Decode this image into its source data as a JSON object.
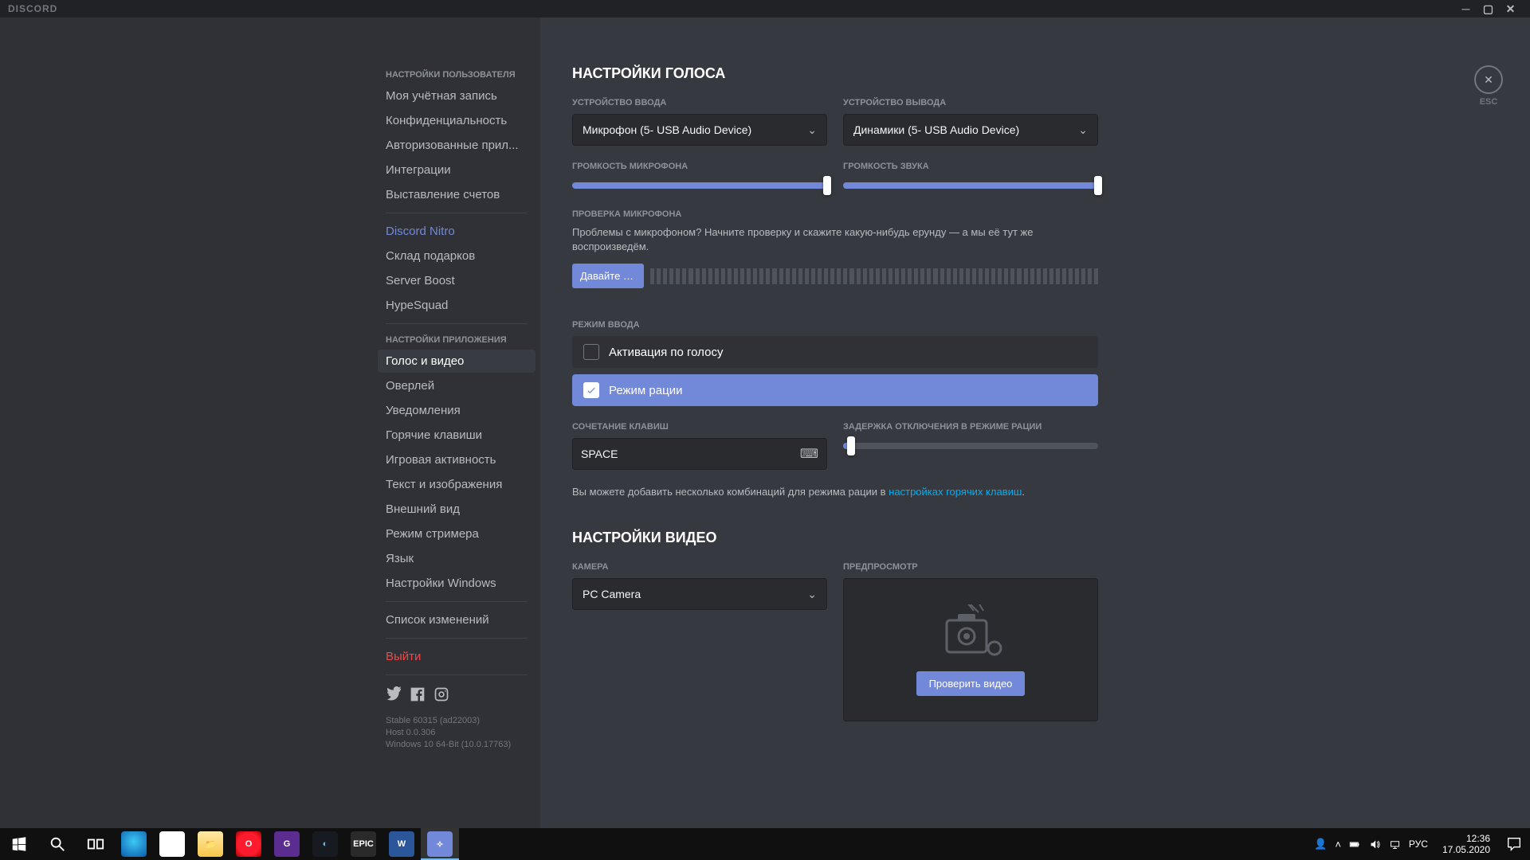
{
  "window": {
    "title": "DISCORD",
    "close_key_label": "ESC"
  },
  "sidebar": {
    "header_user": "НАСТРОЙКИ ПОЛЬЗОВАТЕЛЯ",
    "user_items": [
      "Моя учётная запись",
      "Конфиденциальность",
      "Авторизованные прил...",
      "Интеграции",
      "Выставление счетов"
    ],
    "nitro": "Discord Nitro",
    "nitro_items": [
      "Склад подарков",
      "Server Boost",
      "HypeSquad"
    ],
    "header_app": "НАСТРОЙКИ ПРИЛОЖЕНИЯ",
    "app_items": [
      "Голос и видео",
      "Оверлей",
      "Уведомления",
      "Горячие клавиши",
      "Игровая активность",
      "Текст и изображения",
      "Внешний вид",
      "Режим стримера",
      "Язык",
      "Настройки Windows"
    ],
    "changelog": "Список изменений",
    "logout": "Выйти",
    "version_lines": [
      "Stable 60315 (ad22003)",
      "Host 0.0.306",
      "Windows 10 64-Bit (10.0.17763)"
    ]
  },
  "voice": {
    "title": "НАСТРОЙКИ ГОЛОСА",
    "input_label": "УСТРОЙСТВО ВВОДА",
    "input_device": "Микрофон (5- USB Audio Device)",
    "output_label": "УСТРОЙСТВО ВЫВОДА",
    "output_device": "Динамики (5- USB Audio Device)",
    "input_vol_label": "ГРОМКОСТЬ МИКРОФОНА",
    "input_vol_pct": 100,
    "output_vol_label": "ГРОМКОСТЬ ЗВУКА",
    "output_vol_pct": 100,
    "mictest_label": "ПРОВЕРКА МИКРОФОНА",
    "mictest_hint": "Проблемы с микрофоном? Начните проверку и скажите какую-нибудь ерунду — а мы её тут же воспроизведём.",
    "mictest_button": "Давайте пр...",
    "inputmode_label": "РЕЖИМ ВВОДА",
    "inputmode_voice": "Активация по голосу",
    "inputmode_ptt": "Режим рации",
    "shortcut_label": "СОЧЕТАНИЕ КЛАВИШ",
    "shortcut_value": "SPACE",
    "delay_label": "ЗАДЕРЖКА ОТКЛЮЧЕНИЯ В РЕЖИМЕ РАЦИИ",
    "delay_pct": 3,
    "shortcut_hint_a": "Вы можете добавить несколько комбинаций для режима рации в ",
    "shortcut_hint_link": "настройках горячих клавиш",
    "shortcut_hint_b": "."
  },
  "video": {
    "title": "НАСТРОЙКИ ВИДЕО",
    "cam_label": "КАМЕРА",
    "cam_device": "PC Camera",
    "preview_label": "ПРЕДПРОСМОТР",
    "test_button": "Проверить видео"
  },
  "taskbar": {
    "lang": "РУС",
    "time": "12:36",
    "date": "17.05.2020"
  }
}
